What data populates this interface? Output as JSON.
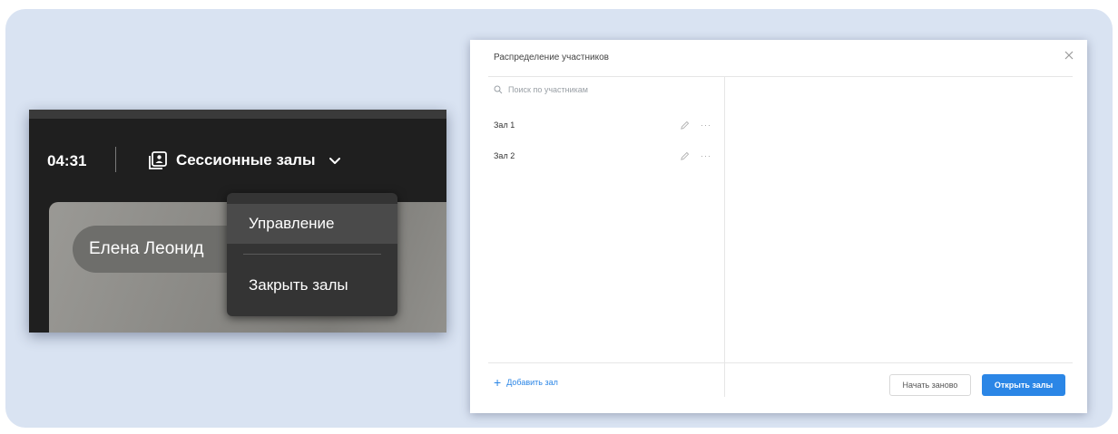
{
  "meeting": {
    "timer": "04:31",
    "rooms_button": "Сессионные залы",
    "participant_name": "Елена Леонид",
    "menu": {
      "items": [
        "Управление",
        "Закрыть залы"
      ]
    }
  },
  "dialog": {
    "title": "Распределение участников",
    "search_placeholder": "Поиск по участникам",
    "rooms": [
      {
        "name": "Зал 1",
        "more": "···"
      },
      {
        "name": "Зал 2",
        "more": "···"
      }
    ],
    "add_room": "Добавить зал",
    "restart_button": "Начать заново",
    "open_button": "Открыть залы"
  },
  "icons": {
    "rooms": "breakout-rooms-icon",
    "chevron": "chevron-down-icon",
    "close": "close-icon",
    "search": "search-icon",
    "edit": "pencil-icon",
    "add": "plus-icon"
  },
  "colors": {
    "accent": "#2b86e6",
    "toolbar_bg": "#1f1f1f",
    "menu_bg": "#343434",
    "canvas_bg": "#d9e3f2"
  }
}
